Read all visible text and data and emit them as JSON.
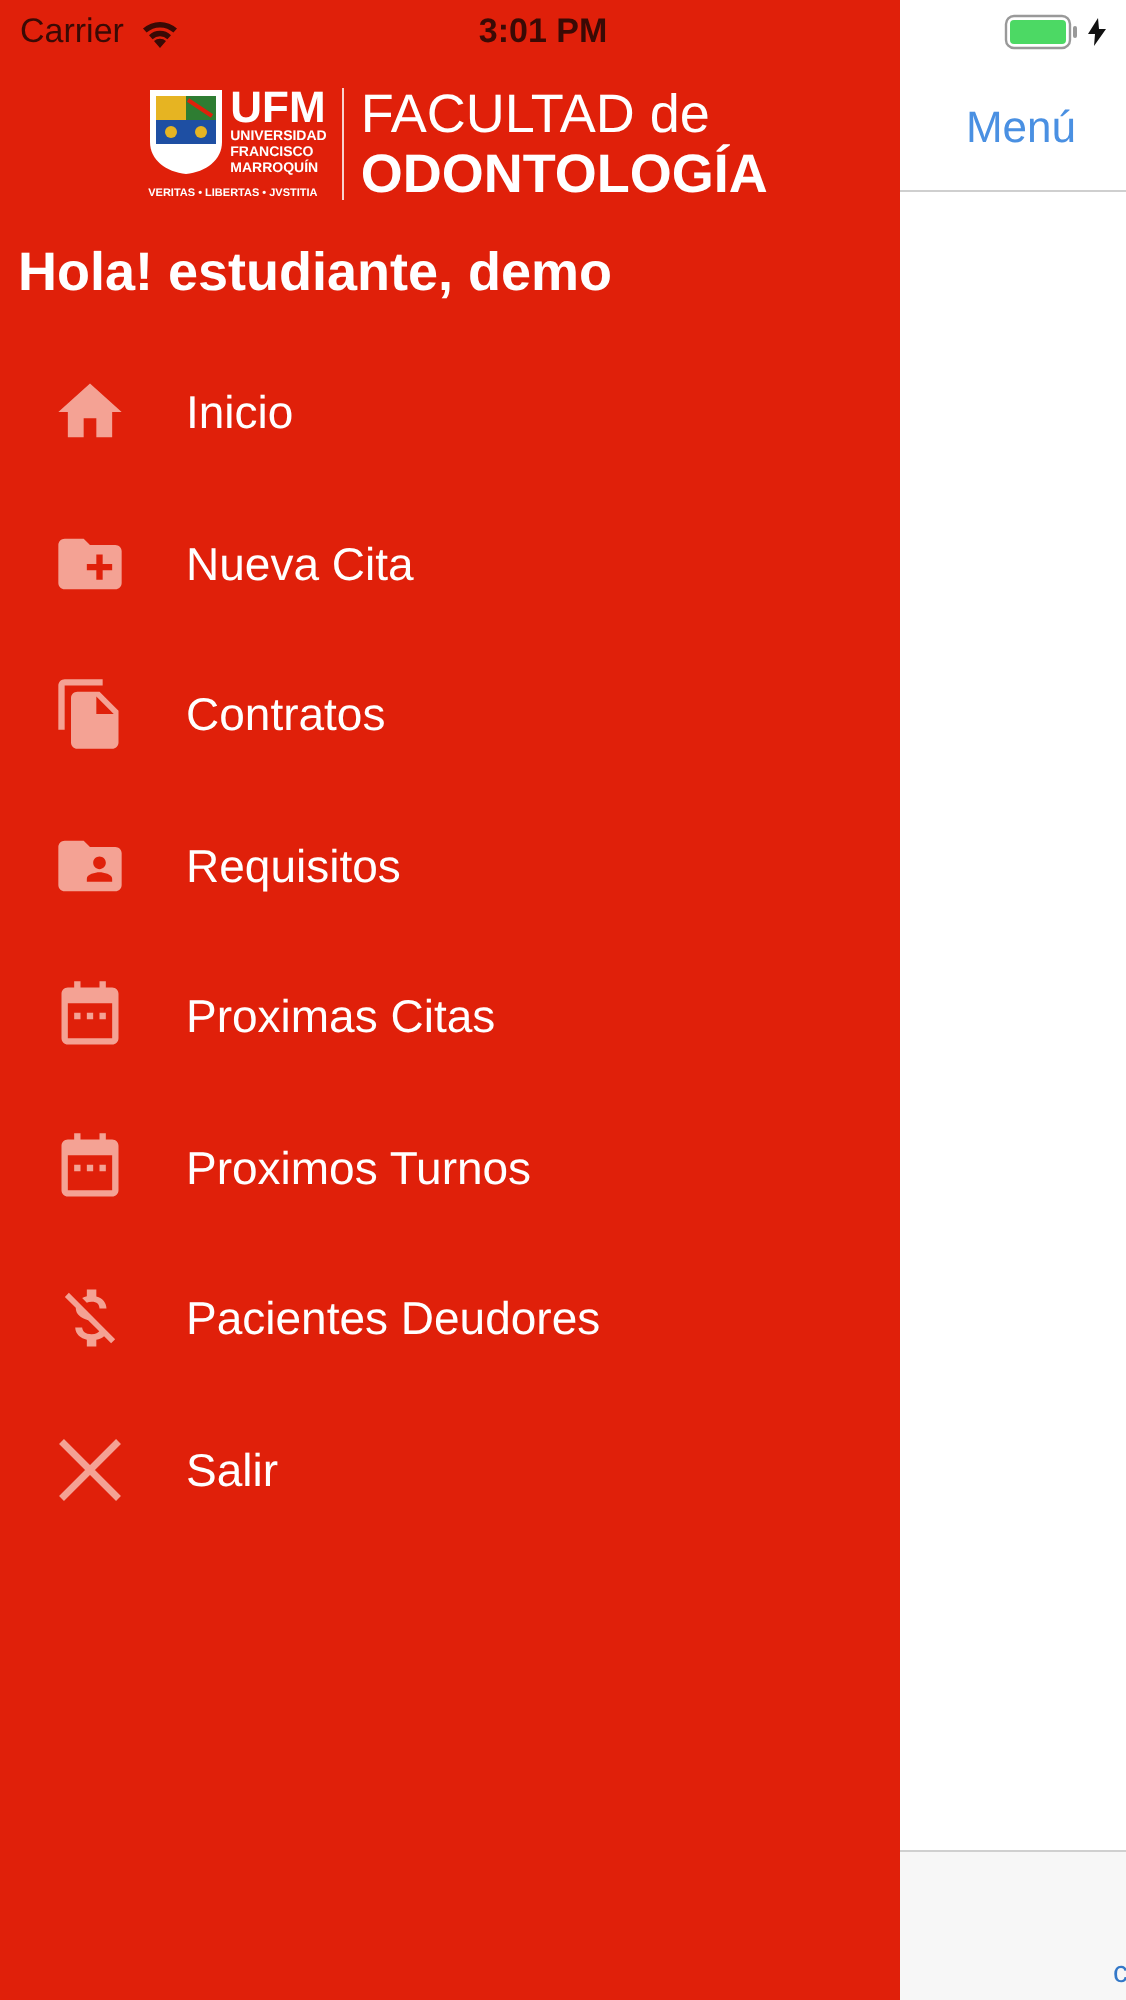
{
  "status_bar": {
    "carrier": "Carrier",
    "time": "3:01 PM",
    "charging": true
  },
  "drawer": {
    "logo": {
      "short": "UFM",
      "lines": [
        "UNIVERSIDAD",
        "FRANCISCO",
        "MARROQUÍN"
      ],
      "motto": "VERITAS • LIBERTAS • JVSTITIA",
      "faculty_top": "FACULTAD de",
      "faculty_bottom": "ODONTOLOGÍA"
    },
    "greeting": "Hola! estudiante, demo",
    "items": [
      {
        "kind": "home",
        "label": "Inicio"
      },
      {
        "kind": "folder-plus",
        "label": "Nueva Cita"
      },
      {
        "kind": "documents",
        "label": "Contratos"
      },
      {
        "kind": "folder-person",
        "label": "Requisitos"
      },
      {
        "kind": "calendar",
        "label": "Proximas Citas"
      },
      {
        "kind": "calendar",
        "label": "Proximos Turnos"
      },
      {
        "kind": "money-off",
        "label": "Pacientes Deudores"
      },
      {
        "kind": "close",
        "label": "Salir"
      }
    ]
  },
  "main": {
    "nav_button": "Menú",
    "tab_label": "c"
  }
}
